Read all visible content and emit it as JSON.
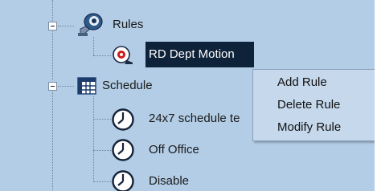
{
  "tree": {
    "rules": {
      "label": "Rules",
      "children": [
        {
          "label": "RD Dept Motion",
          "selected": true
        }
      ]
    },
    "schedule": {
      "label": "Schedule",
      "children": [
        {
          "label": "24x7 schedule te"
        },
        {
          "label": "Off Office"
        },
        {
          "label": "Disable"
        }
      ]
    }
  },
  "context_menu": {
    "items": [
      {
        "label": "Add Rule"
      },
      {
        "label": "Delete Rule"
      },
      {
        "label": "Modify Rule"
      }
    ]
  },
  "colors": {
    "panel_bg": "#b3cde6",
    "selection_bg": "#0e223a",
    "menu_bg": "#c5d8ec"
  }
}
